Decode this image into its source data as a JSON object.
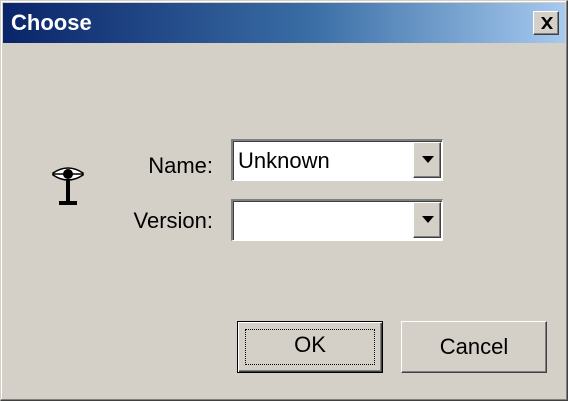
{
  "window": {
    "title": "Choose",
    "close_icon": "close-icon"
  },
  "form": {
    "icon": "antenna-icon",
    "name": {
      "label": "Name:",
      "selected": "Unknown"
    },
    "version": {
      "label": "Version:",
      "selected": ""
    }
  },
  "buttons": {
    "ok_label": "OK",
    "cancel_label": "Cancel"
  }
}
